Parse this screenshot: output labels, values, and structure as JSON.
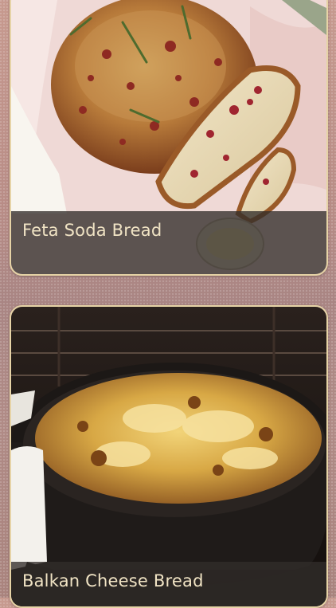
{
  "recipes": [
    {
      "title": "Feta Soda Bread"
    },
    {
      "title": "Balkan Cheese Bread"
    }
  ],
  "colors": {
    "card_border": "#e6d3a6",
    "caption_text": "#f0e3c4",
    "caption_bg": "#322d2a"
  }
}
